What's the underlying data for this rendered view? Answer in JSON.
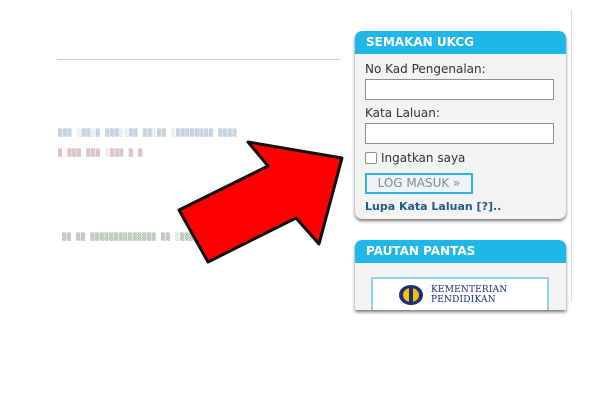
{
  "login_panel": {
    "title": "SEMAKAN UKCG",
    "ic_label": "No Kad Pengenalan:",
    "ic_value": "",
    "password_label": "Kata Laluan:",
    "password_value": "",
    "remember_label": "Ingatkan saya",
    "login_button": "LOG MASUK »",
    "forgot_link": "Lupa Kata Laluan [?].."
  },
  "links_panel": {
    "title": "PAUTAN PANTAS",
    "logo_line1": "KEMENTERIAN",
    "logo_line2": "PENDIDIKAN"
  },
  "colors": {
    "header_blue": "#1fb6e8",
    "arrow_red": "#ff0000",
    "link_blue": "#1f5b8a"
  },
  "icons": {
    "arrow": "red-arrow-icon",
    "emblem": "ministry-emblem-icon"
  }
}
